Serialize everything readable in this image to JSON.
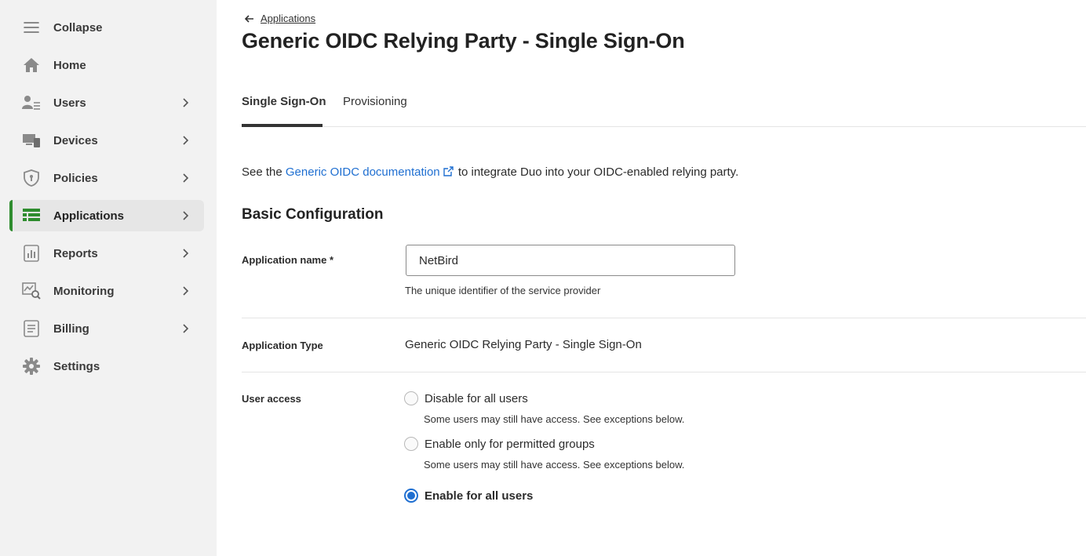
{
  "sidebar": {
    "collapse_label": "Collapse",
    "items": [
      {
        "label": "Home",
        "icon": "home-icon"
      },
      {
        "label": "Users",
        "icon": "users-icon"
      },
      {
        "label": "Devices",
        "icon": "devices-icon"
      },
      {
        "label": "Policies",
        "icon": "shield-icon"
      },
      {
        "label": "Applications",
        "icon": "applications-icon",
        "active": true
      },
      {
        "label": "Reports",
        "icon": "reports-icon"
      },
      {
        "label": "Monitoring",
        "icon": "monitoring-icon"
      },
      {
        "label": "Billing",
        "icon": "billing-icon"
      },
      {
        "label": "Settings",
        "icon": "gear-icon"
      }
    ],
    "active_color": "#2e8c2e"
  },
  "breadcrumb": {
    "back_label": "Applications"
  },
  "page": {
    "title": "Generic OIDC Relying Party - Single Sign-On"
  },
  "tabs": [
    {
      "label": "Single Sign-On",
      "active": true
    },
    {
      "label": "Provisioning",
      "active": false
    }
  ],
  "intro": {
    "prefix": "See the ",
    "link_text": "Generic OIDC documentation",
    "suffix": " to integrate Duo into your OIDC-enabled relying party."
  },
  "basic_config": {
    "title": "Basic Configuration",
    "app_name_label": "Application name *",
    "app_name_value": "NetBird",
    "app_name_help": "The unique identifier of the service provider",
    "app_type_label": "Application Type",
    "app_type_value": "Generic OIDC Relying Party - Single Sign-On",
    "user_access_label": "User access",
    "user_access_options": [
      {
        "label": "Disable for all users",
        "help": "Some users may still have access. See exceptions below.",
        "checked": false
      },
      {
        "label": "Enable only for permitted groups",
        "help": "Some users may still have access. See exceptions below.",
        "checked": false
      },
      {
        "label": "Enable for all users",
        "help": "",
        "checked": true
      }
    ]
  },
  "colors": {
    "link": "#1f6fd1",
    "radio_checked": "#1f6fd1"
  }
}
